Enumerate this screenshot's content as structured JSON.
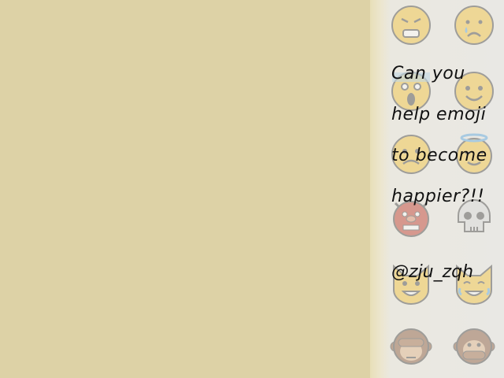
{
  "game": {
    "message_lines": [
      "Can you",
      "help emoji",
      "to become",
      "happier?!!"
    ],
    "credit": "@zju_zqh"
  },
  "colors": {
    "play_area": "#ddd2a6",
    "sidebar": "#e9e8e4",
    "emoji_face": "#f5c33b",
    "monkey": "#8b5a3c",
    "ogre": "#c0392b",
    "skull": "#d9d9d9"
  },
  "emoji_icons": [
    "persevering-face-icon",
    "crying-face-icon",
    "screaming-face-icon",
    "grinning-face-icon",
    "anxious-face-icon",
    "halo-face-icon",
    "ogre-icon",
    "skull-icon",
    "grinning-cat-icon",
    "joy-cat-icon",
    "see-no-evil-monkey-icon",
    "speak-no-evil-monkey-icon"
  ]
}
